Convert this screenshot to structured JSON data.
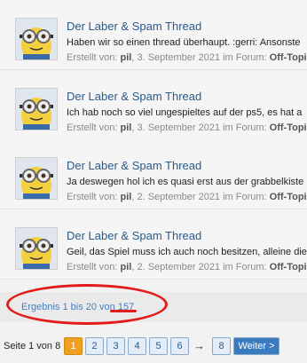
{
  "results": [
    {
      "title": "Der Laber & Spam Thread",
      "excerpt": "Haben wir so einen thread überhaupt. :gerri: Ansonste",
      "created_prefix": "Erstellt von: ",
      "author": "pil",
      "date_and_forum": ", 3. September 2021 im Forum: ",
      "forum": "Off-Topic"
    },
    {
      "title": "Der Laber & Spam Thread",
      "excerpt": "Ich hab noch so viel ungespieltes auf der ps5, es hat a",
      "created_prefix": "Erstellt von: ",
      "author": "pil",
      "date_and_forum": ", 3. September 2021 im Forum: ",
      "forum": "Off-Topic"
    },
    {
      "title": "Der Laber & Spam Thread",
      "excerpt": "Ja deswegen hol ich es quasi erst aus der grabbelkiste",
      "created_prefix": "Erstellt von: ",
      "author": "pil",
      "date_and_forum": ", 2. September 2021 im Forum: ",
      "forum": "Off-Topic"
    },
    {
      "title": "Der Laber & Spam Thread",
      "excerpt": "Geil, das Spiel muss ich auch noch besitzen, alleine die",
      "created_prefix": "Erstellt von: ",
      "author": "pil",
      "date_and_forum": ", 2. September 2021 im Forum: ",
      "forum": "Off-Topic"
    }
  ],
  "result_count": "Ergebnis 1 bis 20 von 157",
  "pager": {
    "label": "Seite 1 von 8",
    "pages": [
      "1",
      "2",
      "3",
      "4",
      "5",
      "6"
    ],
    "arrow": "→",
    "last_page": "8",
    "next_label": "Weiter >"
  },
  "colors": {
    "link": "#2a5a8a",
    "annotation_red": "#e21b1b",
    "current_page": "#f0a020"
  }
}
